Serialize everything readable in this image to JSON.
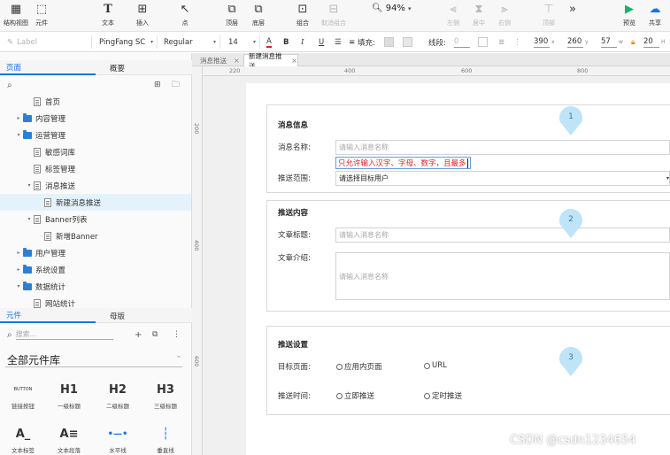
{
  "toolbar": {
    "items": [
      {
        "label": "结构视图",
        "icon": "▦",
        "name": "outline-view-tool"
      },
      {
        "label": "元件",
        "icon": "⬚",
        "name": "widget-tool"
      },
      {
        "label": "文本",
        "icon": "T",
        "name": "text-tool"
      },
      {
        "label": "插入",
        "icon": "⊞",
        "name": "insert-tool"
      },
      {
        "label": "点",
        "icon": "↖",
        "name": "point-tool"
      },
      {
        "label": "顶层",
        "icon": "⧉",
        "name": "bring-front-tool"
      },
      {
        "label": "底层",
        "icon": "⧉",
        "name": "send-back-tool"
      },
      {
        "label": "组合",
        "icon": "⊡",
        "name": "group-tool"
      },
      {
        "label": "取消组合",
        "icon": "⊟",
        "name": "ungroup-tool"
      },
      {
        "label": "左侧",
        "icon": "⫷",
        "name": "align-left-tool"
      },
      {
        "label": "居中",
        "icon": "⧗",
        "name": "align-center-tool"
      },
      {
        "label": "右侧",
        "icon": "⫸",
        "name": "align-right-tool"
      },
      {
        "label": "顶部",
        "icon": "⊤",
        "name": "align-top-tool"
      },
      {
        "label": "预览",
        "icon": "▶",
        "name": "preview-tool"
      },
      {
        "label": "共享",
        "icon": "☁",
        "name": "share-tool"
      }
    ],
    "zoom": "94%",
    "more": "»"
  },
  "formatbar": {
    "style_placeholder": "Label",
    "font_family": "PingFang SC",
    "font_weight": "Regular",
    "font_size": "14",
    "fill_label": "填充:",
    "stroke_label": "线段:",
    "stroke_value": "0",
    "x": "390",
    "y": "260",
    "w": "57",
    "h": "20",
    "x_label": "x",
    "y_label": "y",
    "w_label": "w",
    "h_label": "H"
  },
  "pages_panel": {
    "tabs": [
      "页面",
      "概要"
    ],
    "tree": [
      {
        "label": "首页",
        "type": "page",
        "level": 1,
        "arrow": ""
      },
      {
        "label": "内容管理",
        "type": "folder",
        "level": 0,
        "arrow": "▸"
      },
      {
        "label": "运营管理",
        "type": "folder",
        "level": 0,
        "arrow": "▾"
      },
      {
        "label": "敏感词库",
        "type": "page",
        "level": 1,
        "arrow": ""
      },
      {
        "label": "标签管理",
        "type": "page",
        "level": 1,
        "arrow": ""
      },
      {
        "label": "消息推送",
        "type": "page",
        "level": 1,
        "arrow": "▾"
      },
      {
        "label": "新建消息推送",
        "type": "page",
        "level": 2,
        "arrow": "",
        "selected": true
      },
      {
        "label": "Banner列表",
        "type": "page",
        "level": 1,
        "arrow": "▾"
      },
      {
        "label": "新增Banner",
        "type": "page",
        "level": 2,
        "arrow": ""
      },
      {
        "label": "用户管理",
        "type": "folder",
        "level": 0,
        "arrow": "▸"
      },
      {
        "label": "系统设置",
        "type": "folder",
        "level": 0,
        "arrow": "▸"
      },
      {
        "label": "数据统计",
        "type": "folder",
        "level": 0,
        "arrow": "▾"
      },
      {
        "label": "网站统计",
        "type": "page",
        "level": 1,
        "arrow": ""
      }
    ]
  },
  "widgets_panel": {
    "tabs": [
      "元件",
      "母版"
    ],
    "search_placeholder": "搜索...",
    "library": "全部元件库",
    "widgets": [
      {
        "icon": "BUTTON",
        "label": "链接按钮"
      },
      {
        "icon": "H1",
        "label": "一级标题"
      },
      {
        "icon": "H2",
        "label": "二级标题"
      },
      {
        "icon": "H3",
        "label": "三级标题"
      },
      {
        "icon": "A_",
        "label": "文本标签"
      },
      {
        "icon": "A≡",
        "label": "文本段落"
      },
      {
        "icon": "•—•",
        "label": "水平线"
      },
      {
        "icon": "┆",
        "label": "垂直线"
      }
    ]
  },
  "doc_tabs": [
    {
      "label": "消息推送",
      "active": false
    },
    {
      "label": "新建消息推送",
      "active": true
    }
  ],
  "rulers": {
    "h": [
      "220",
      "400",
      "600",
      "800"
    ],
    "v": [
      "200",
      "400",
      "600"
    ]
  },
  "form": {
    "sections": [
      {
        "title": "消息信息",
        "name_label": "消息名称:",
        "name_placeholder": "请输入消息名称",
        "validation": "只允许输入汉字、字母、数字，且最多",
        "scope_label": "推送范围:",
        "scope_value": "请选择目标用户",
        "marker": "1"
      },
      {
        "title": "推送内容",
        "article_title_label": "文章标题:",
        "article_title_placeholder": "请输入消息名称",
        "article_intro_label": "文章介绍:",
        "article_intro_placeholder": "请输入消息名称",
        "marker": "2"
      },
      {
        "title": "推送设置",
        "target_label": "目标页面:",
        "target_options": [
          "应用内页面",
          "URL"
        ],
        "time_label": "推送时间:",
        "time_options": [
          "立即推送",
          "定时推送"
        ],
        "marker": "3"
      }
    ]
  },
  "watermark": "CSDN @csdn1234654",
  "colors": {
    "accent": "#1a73e8",
    "folder": "#2d7fd4",
    "marker": "#bfe3f7",
    "error": "#e02020",
    "selected_row": "#e4f3fb"
  }
}
